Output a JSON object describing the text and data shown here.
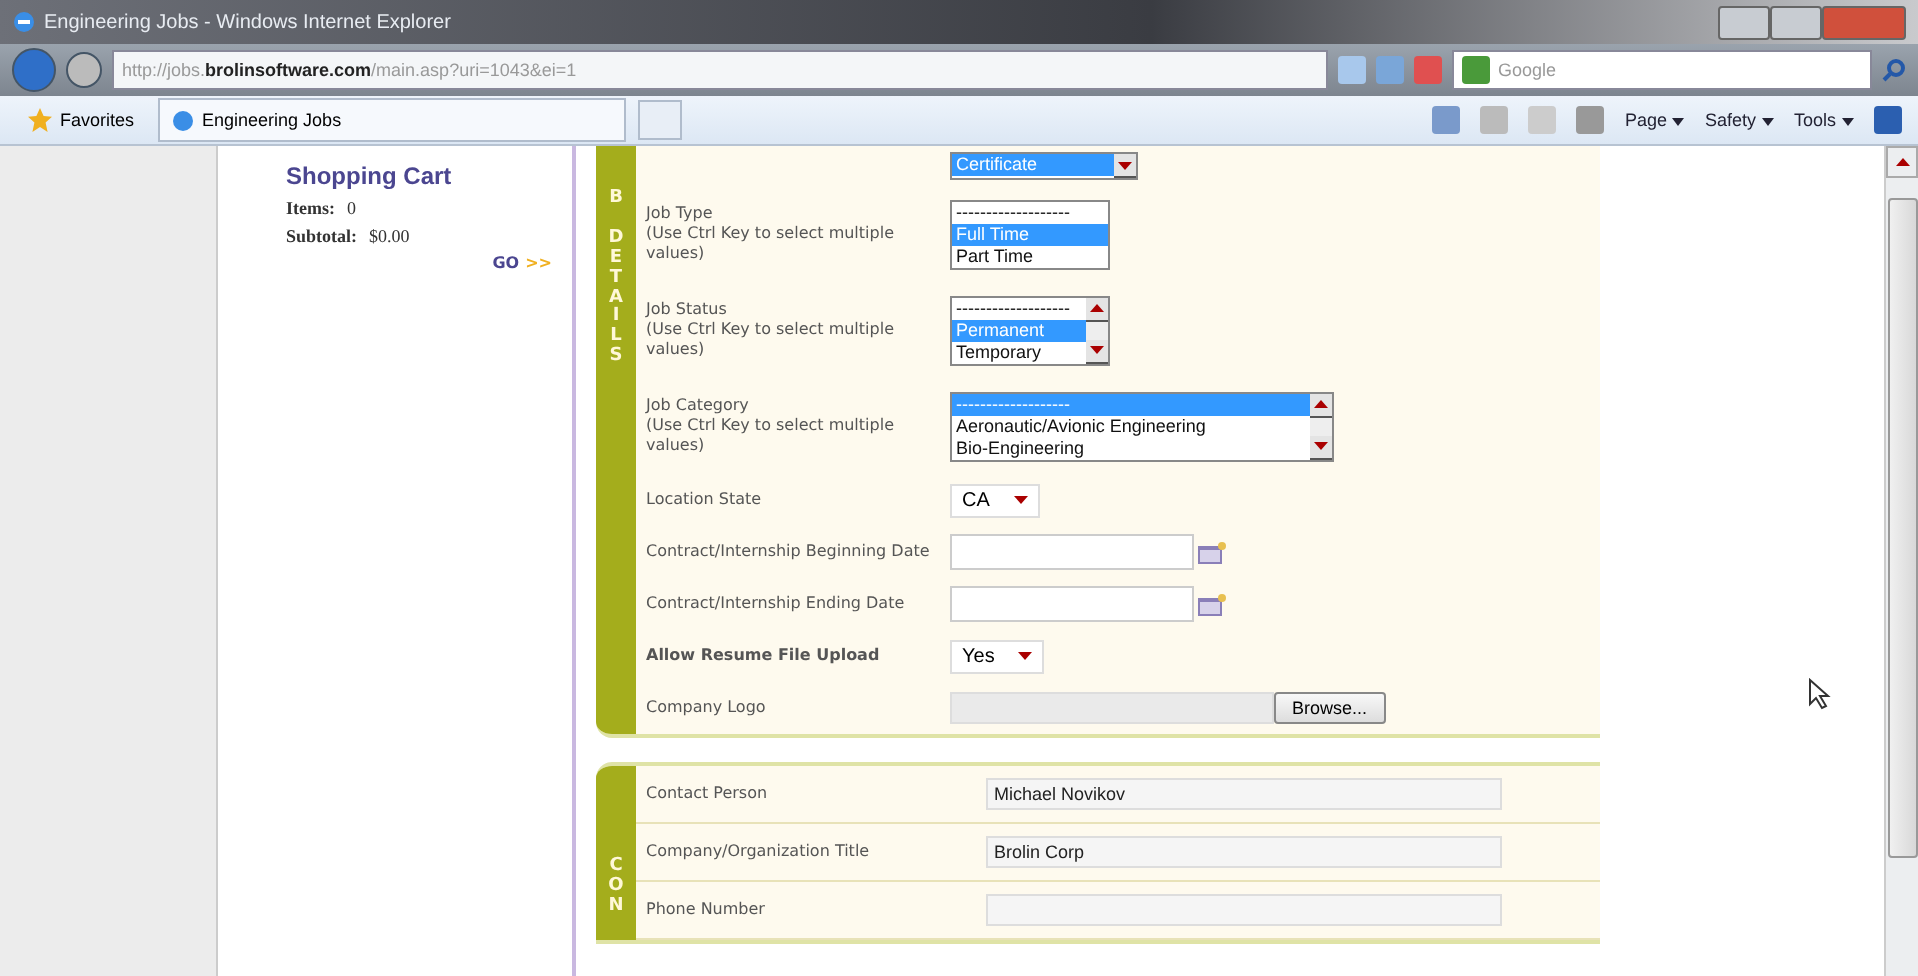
{
  "window": {
    "title": "Engineering Jobs - Windows Internet Explorer"
  },
  "address_bar": {
    "url_host": "http://jobs.",
    "url_domain": "brolinsoftware.com",
    "url_path": "/main.asp?uri=1043&ei=1",
    "search_placeholder": "Google"
  },
  "favorites_bar": {
    "favorites": "Favorites",
    "tabs": [
      {
        "label": "Engineering Jobs",
        "selected": true
      }
    ],
    "commands": [
      "Page",
      "Safety",
      "Tools"
    ]
  },
  "sidebar": {
    "title": "Shopping Cart",
    "items_label": "Items:",
    "items_value": "0",
    "subtotal_label": "Subtotal:",
    "subtotal_value": "$0.00",
    "go": "GO",
    "go_arrows": ">>"
  },
  "sections": [
    {
      "side_label": [
        "B",
        "DETAILS"
      ],
      "rows": [
        {
          "kind": "listbox",
          "scrollable": true,
          "options": [
            {
              "label": "Certificate",
              "selected": true
            }
          ]
        },
        {
          "kind": "listbox",
          "label": "Job Type",
          "hint": "(Use Ctrl Key to select multiple values)",
          "scrollable": false,
          "options": [
            {
              "label": "-------------------",
              "selected": false
            },
            {
              "label": "Full Time",
              "selected": true
            },
            {
              "label": "Part Time",
              "selected": false
            }
          ]
        },
        {
          "kind": "listbox",
          "label": "Job Status",
          "hint": "(Use Ctrl Key to select multiple values)",
          "scrollable": true,
          "options": [
            {
              "label": "-------------------",
              "selected": false
            },
            {
              "label": "Permanent",
              "selected": true
            },
            {
              "label": "Temporary",
              "selected": false
            }
          ]
        },
        {
          "kind": "listbox",
          "label": "Job Category",
          "hint": "(Use Ctrl Key to select multiple values)",
          "scrollable": true,
          "options": [
            {
              "label": "-------------------",
              "selected": true
            },
            {
              "label": "Aeronautic/Avionic Engineering",
              "selected": false
            },
            {
              "label": "Bio-Engineering",
              "selected": false
            }
          ]
        },
        {
          "kind": "select",
          "label": "Location State",
          "value": "CA",
          "bold": false
        },
        {
          "kind": "date",
          "label": "Contract/Internship Beginning Date",
          "bold": false
        },
        {
          "kind": "date",
          "label": "Contract/Internship Ending Date",
          "bold": false
        },
        {
          "kind": "select",
          "label": "Allow Resume File Upload",
          "value": "Yes",
          "bold": true
        },
        {
          "kind": "file",
          "label": "Company Logo",
          "button": "Browse...",
          "bold": false
        }
      ]
    },
    {
      "side_label": [
        "CON"
      ],
      "rows": [
        {
          "kind": "text",
          "label": "Contact Person",
          "value": "Michael Novikov",
          "bold": false
        },
        {
          "kind": "text",
          "label": "Company/Organization Title",
          "value": "Brolin Corp",
          "bold": false
        },
        {
          "kind": "text",
          "label": "Phone Number",
          "value": "",
          "bold": false
        }
      ]
    }
  ]
}
